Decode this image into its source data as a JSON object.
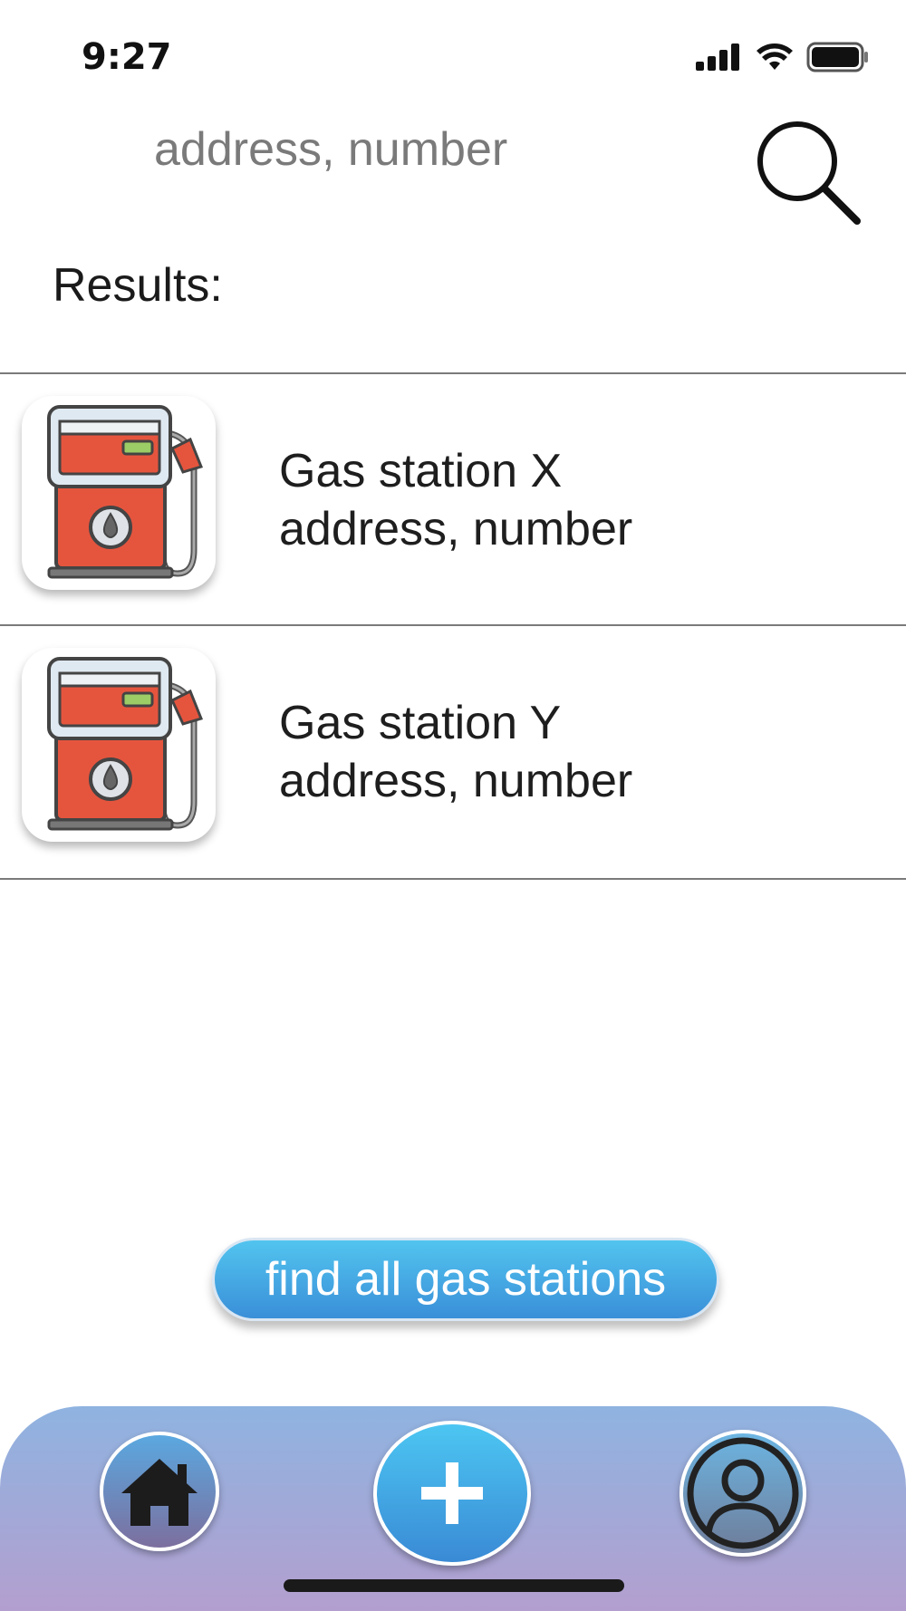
{
  "status_bar": {
    "time": "9:27",
    "icons": [
      "cellular-signal-icon",
      "wifi-icon",
      "battery-icon"
    ]
  },
  "search": {
    "placeholder": "address, number",
    "value": "",
    "button_icon": "search-icon"
  },
  "results_label": "Results:",
  "results": [
    {
      "name": "Gas station X",
      "address": "address, number",
      "icon": "gas-pump-icon"
    },
    {
      "name": "Gas station Y",
      "address": "address, number",
      "icon": "gas-pump-icon"
    }
  ],
  "find_all_label": "find all gas stations",
  "bottom_nav": {
    "items": [
      {
        "icon": "home-icon"
      },
      {
        "icon": "plus-icon"
      },
      {
        "icon": "profile-icon"
      }
    ]
  },
  "colors": {
    "accent_blue": "#3a8fd8",
    "pump_red": "#e5553e",
    "pump_green": "#9ccc65",
    "nav_gradient_top": "#8fb3e0",
    "nav_gradient_bottom": "#b39fcf"
  }
}
